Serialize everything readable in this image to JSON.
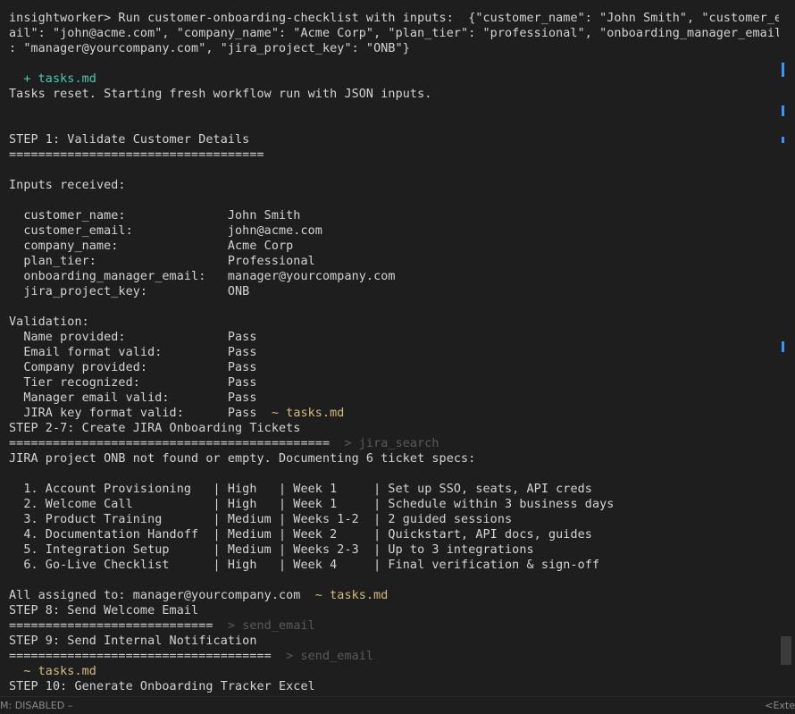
{
  "terminal": {
    "lines": [
      {
        "text": "insightworker> Run customer-onboarding-checklist with inputs:  {\"customer_name\": \"John Smith\", \"customer_em"
      },
      {
        "text": "ail\": \"john@acme.com\", \"company_name\": \"Acme Corp\", \"plan_tier\": \"professional\", \"onboarding_manager_email\""
      },
      {
        "text": ": \"manager@yourcompany.com\", \"jira_project_key\": \"ONB\"}"
      },
      {
        "text": ""
      },
      {
        "text": "  + tasks.md",
        "style": "green"
      },
      {
        "text": "Tasks reset. Starting fresh workflow run with JSON inputs."
      },
      {
        "text": ""
      },
      {
        "text": ""
      },
      {
        "text": "STEP 1: Validate Customer Details"
      },
      {
        "text": "==================================="
      },
      {
        "text": ""
      },
      {
        "text": "Inputs received:"
      },
      {
        "text": ""
      },
      {
        "text": "  customer_name:              John Smith"
      },
      {
        "text": "  customer_email:             john@acme.com"
      },
      {
        "text": "  company_name:               Acme Corp"
      },
      {
        "text": "  plan_tier:                  Professional"
      },
      {
        "text": "  onboarding_manager_email:   manager@yourcompany.com"
      },
      {
        "text": "  jira_project_key:           ONB"
      },
      {
        "text": ""
      },
      {
        "text": "Validation:"
      },
      {
        "text": "  Name provided:              Pass"
      },
      {
        "text": "  Email format valid:         Pass"
      },
      {
        "text": "  Company provided:           Pass"
      },
      {
        "text": "  Tier recognized:            Pass"
      },
      {
        "text": "  Manager email valid:        Pass"
      },
      {
        "text": "  JIRA key format valid:      Pass",
        "suffix": "  ~ tasks.md",
        "suffix_style": "tilde"
      },
      {
        "text": "STEP 2-7: Create JIRA Onboarding Tickets"
      },
      {
        "text": "============================================",
        "suffix": "  > jira_search",
        "suffix_style": "dim"
      },
      {
        "text": "JIRA project ONB not found or empty. Documenting 6 ticket specs:"
      },
      {
        "text": ""
      },
      {
        "text": "  1. Account Provisioning   | High   | Week 1     | Set up SSO, seats, API creds"
      },
      {
        "text": "  2. Welcome Call           | High   | Week 1     | Schedule within 3 business days"
      },
      {
        "text": "  3. Product Training       | Medium | Weeks 1-2  | 2 guided sessions"
      },
      {
        "text": "  4. Documentation Handoff  | Medium | Week 2     | Quickstart, API docs, guides"
      },
      {
        "text": "  5. Integration Setup      | Medium | Weeks 2-3  | Up to 3 integrations"
      },
      {
        "text": "  6. Go-Live Checklist      | High   | Week 4     | Final verification & sign-off"
      },
      {
        "text": ""
      },
      {
        "text": "All assigned to: manager@yourcompany.com",
        "suffix": "  ~ tasks.md",
        "suffix_style": "tilde"
      },
      {
        "text": "STEP 8: Send Welcome Email"
      },
      {
        "text": "============================",
        "suffix": "  > send_email",
        "suffix_style": "dim"
      },
      {
        "text": "STEP 9: Send Internal Notification"
      },
      {
        "text": "====================================",
        "suffix": "  > send_email",
        "suffix_style": "dim"
      },
      {
        "text": "  ~ tasks.md",
        "style": "tilde"
      },
      {
        "text": "STEP 10: Generate Onboarding Tracker Excel"
      }
    ]
  },
  "status_bar": {
    "left": "M: DISABLED –",
    "right": "<Exte"
  },
  "colors": {
    "background": "#1e1e1e",
    "foreground": "#d4d4d4",
    "added": "#4ec9b0",
    "modified": "#d7ba7d",
    "tool_call": "#5a5a5a",
    "scroll_marker": "#3794ff"
  }
}
